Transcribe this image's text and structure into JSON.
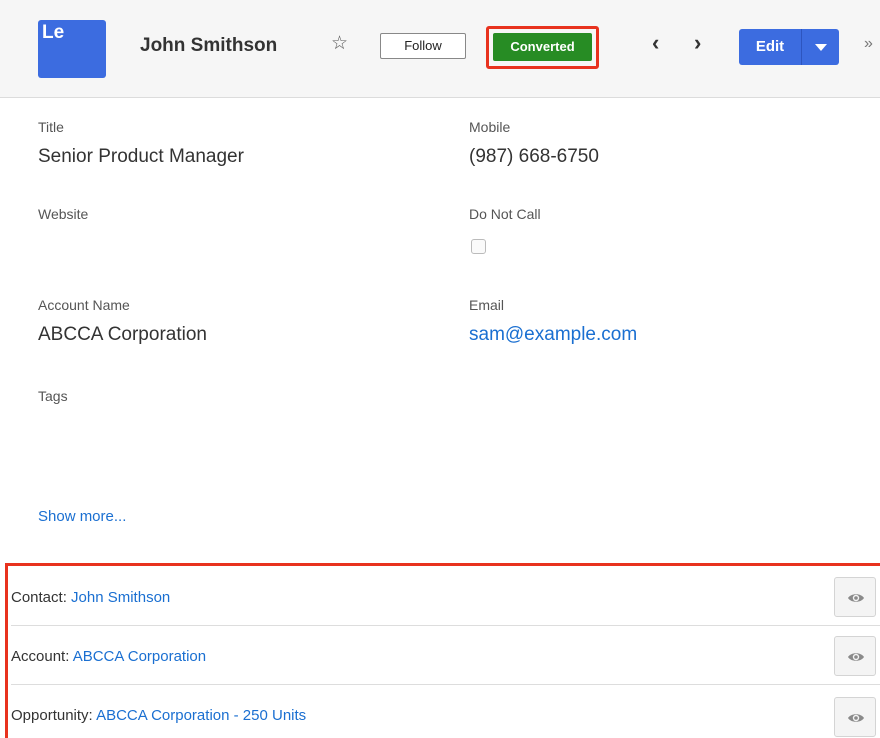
{
  "header": {
    "avatar_text": "Le",
    "name": "John Smithson",
    "star_icon": "star-outline-icon",
    "follow_label": "Follow",
    "status_badge": "Converted",
    "prev_icon": "chevron-left-icon",
    "next_icon": "chevron-right-icon",
    "edit_label": "Edit",
    "more_icon": "double-chevron-right-icon",
    "status_color": "#278c24",
    "accent_color": "#3c6ce0",
    "highlight_color": "#e8321e"
  },
  "fields": {
    "title_label": "Title",
    "title_value": "Senior Product Manager",
    "mobile_label": "Mobile",
    "mobile_value": "(987) 668-6750",
    "website_label": "Website",
    "website_value": "",
    "do_not_call_label": "Do Not Call",
    "do_not_call_checked": false,
    "account_label": "Account Name",
    "account_value": "ABCCA Corporation",
    "email_label": "Email",
    "email_value": "sam@example.com",
    "tags_label": "Tags"
  },
  "show_more": "Show more...",
  "related": [
    {
      "prefix": "Contact: ",
      "link": "John Smithson",
      "icon": "eye-icon"
    },
    {
      "prefix": "Account: ",
      "link": "ABCCA Corporation",
      "icon": "eye-icon"
    },
    {
      "prefix": "Opportunity: ",
      "link": "ABCCA Corporation - 250 Units",
      "icon": "eye-icon"
    }
  ]
}
